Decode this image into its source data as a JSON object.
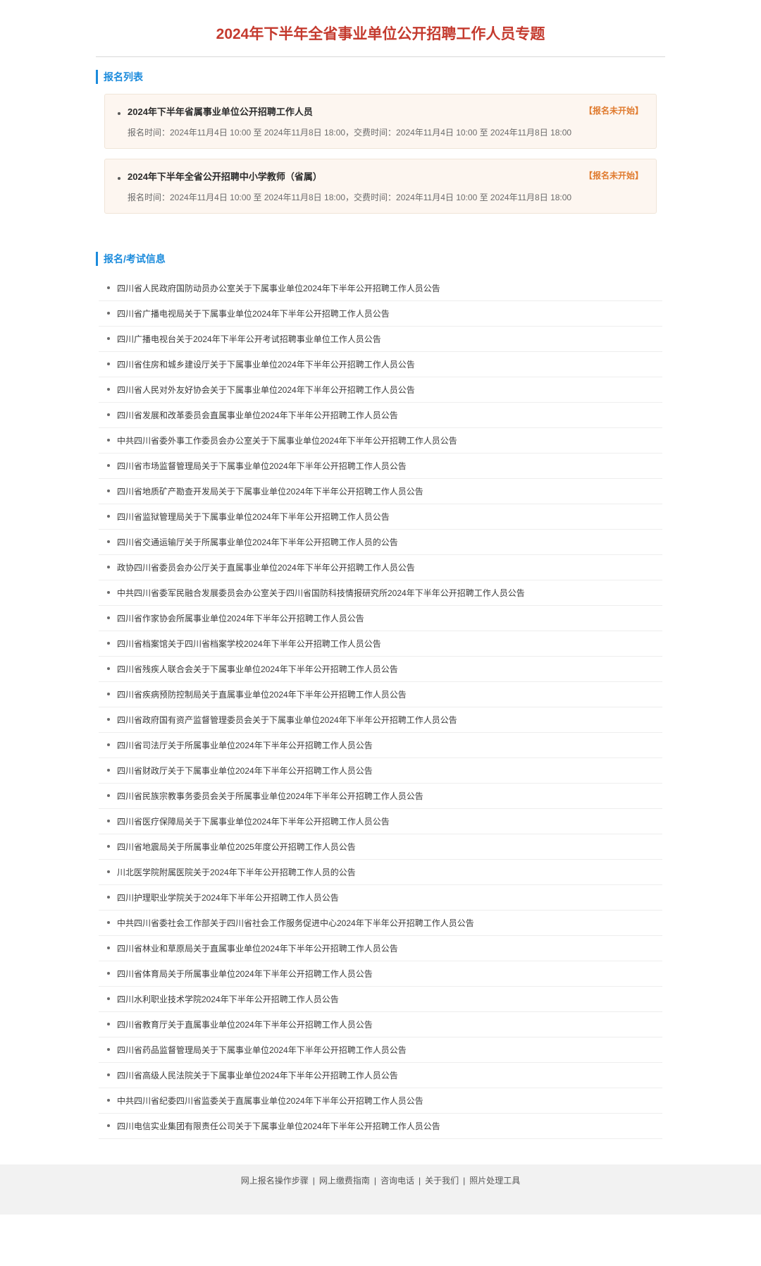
{
  "page_title": "2024年下半年全省事业单位公开招聘工作人员专题",
  "section_reg_header": "报名列表",
  "section_info_header": "报名/考试信息",
  "registrations": [
    {
      "title": "2024年下半年省属事业单位公开招聘工作人员",
      "status": "【报名未开始】",
      "meta": "报名时间：2024年11月4日 10:00 至 2024年11月8日 18:00，交费时间：2024年11月4日 10:00 至 2024年11月8日 18:00"
    },
    {
      "title": "2024年下半年全省公开招聘中小学教师（省属）",
      "status": "【报名未开始】",
      "meta": "报名时间：2024年11月4日 10:00 至 2024年11月8日 18:00，交费时间：2024年11月4日 10:00 至 2024年11月8日 18:00"
    }
  ],
  "info_items": [
    "四川省人民政府国防动员办公室关于下属事业单位2024年下半年公开招聘工作人员公告",
    "四川省广播电视局关于下属事业单位2024年下半年公开招聘工作人员公告",
    "四川广播电视台关于2024年下半年公开考试招聘事业单位工作人员公告",
    "四川省住房和城乡建设厅关于下属事业单位2024年下半年公开招聘工作人员公告",
    "四川省人民对外友好协会关于下属事业单位2024年下半年公开招聘工作人员公告",
    "四川省发展和改革委员会直属事业单位2024年下半年公开招聘工作人员公告",
    "中共四川省委外事工作委员会办公室关于下属事业单位2024年下半年公开招聘工作人员公告",
    "四川省市场监督管理局关于下属事业单位2024年下半年公开招聘工作人员公告",
    "四川省地质矿产勘查开发局关于下属事业单位2024年下半年公开招聘工作人员公告",
    "四川省监狱管理局关于下属事业单位2024年下半年公开招聘工作人员公告",
    "四川省交通运输厅关于所属事业单位2024年下半年公开招聘工作人员的公告",
    "政协四川省委员会办公厅关于直属事业单位2024年下半年公开招聘工作人员公告",
    "中共四川省委军民融合发展委员会办公室关于四川省国防科技情报研究所2024年下半年公开招聘工作人员公告",
    "四川省作家协会所属事业单位2024年下半年公开招聘工作人员公告",
    "四川省档案馆关于四川省档案学校2024年下半年公开招聘工作人员公告",
    "四川省残疾人联合会关于下属事业单位2024年下半年公开招聘工作人员公告",
    "四川省疾病预防控制局关于直属事业单位2024年下半年公开招聘工作人员公告",
    "四川省政府国有资产监督管理委员会关于下属事业单位2024年下半年公开招聘工作人员公告",
    "四川省司法厅关于所属事业单位2024年下半年公开招聘工作人员公告",
    "四川省财政厅关于下属事业单位2024年下半年公开招聘工作人员公告",
    "四川省民族宗教事务委员会关于所属事业单位2024年下半年公开招聘工作人员公告",
    "四川省医疗保障局关于下属事业单位2024年下半年公开招聘工作人员公告",
    "四川省地震局关于所属事业单位2025年度公开招聘工作人员公告",
    "川北医学院附属医院关于2024年下半年公开招聘工作人员的公告",
    "四川护理职业学院关于2024年下半年公开招聘工作人员公告",
    "中共四川省委社会工作部关于四川省社会工作服务促进中心2024年下半年公开招聘工作人员公告",
    "四川省林业和草原局关于直属事业单位2024年下半年公开招聘工作人员公告",
    "四川省体育局关于所属事业单位2024年下半年公开招聘工作人员公告",
    "四川水利职业技术学院2024年下半年公开招聘工作人员公告",
    "四川省教育厅关于直属事业单位2024年下半年公开招聘工作人员公告",
    "四川省药品监督管理局关于下属事业单位2024年下半年公开招聘工作人员公告",
    "四川省高级人民法院关于下属事业单位2024年下半年公开招聘工作人员公告",
    "中共四川省纪委四川省监委关于直属事业单位2024年下半年公开招聘工作人员公告",
    "四川电信实业集团有限责任公司关于下属事业单位2024年下半年公开招聘工作人员公告"
  ],
  "footer": {
    "links": [
      "网上报名操作步骤",
      "网上缴费指南",
      "咨询电话",
      "关于我们",
      "照片处理工具"
    ]
  }
}
